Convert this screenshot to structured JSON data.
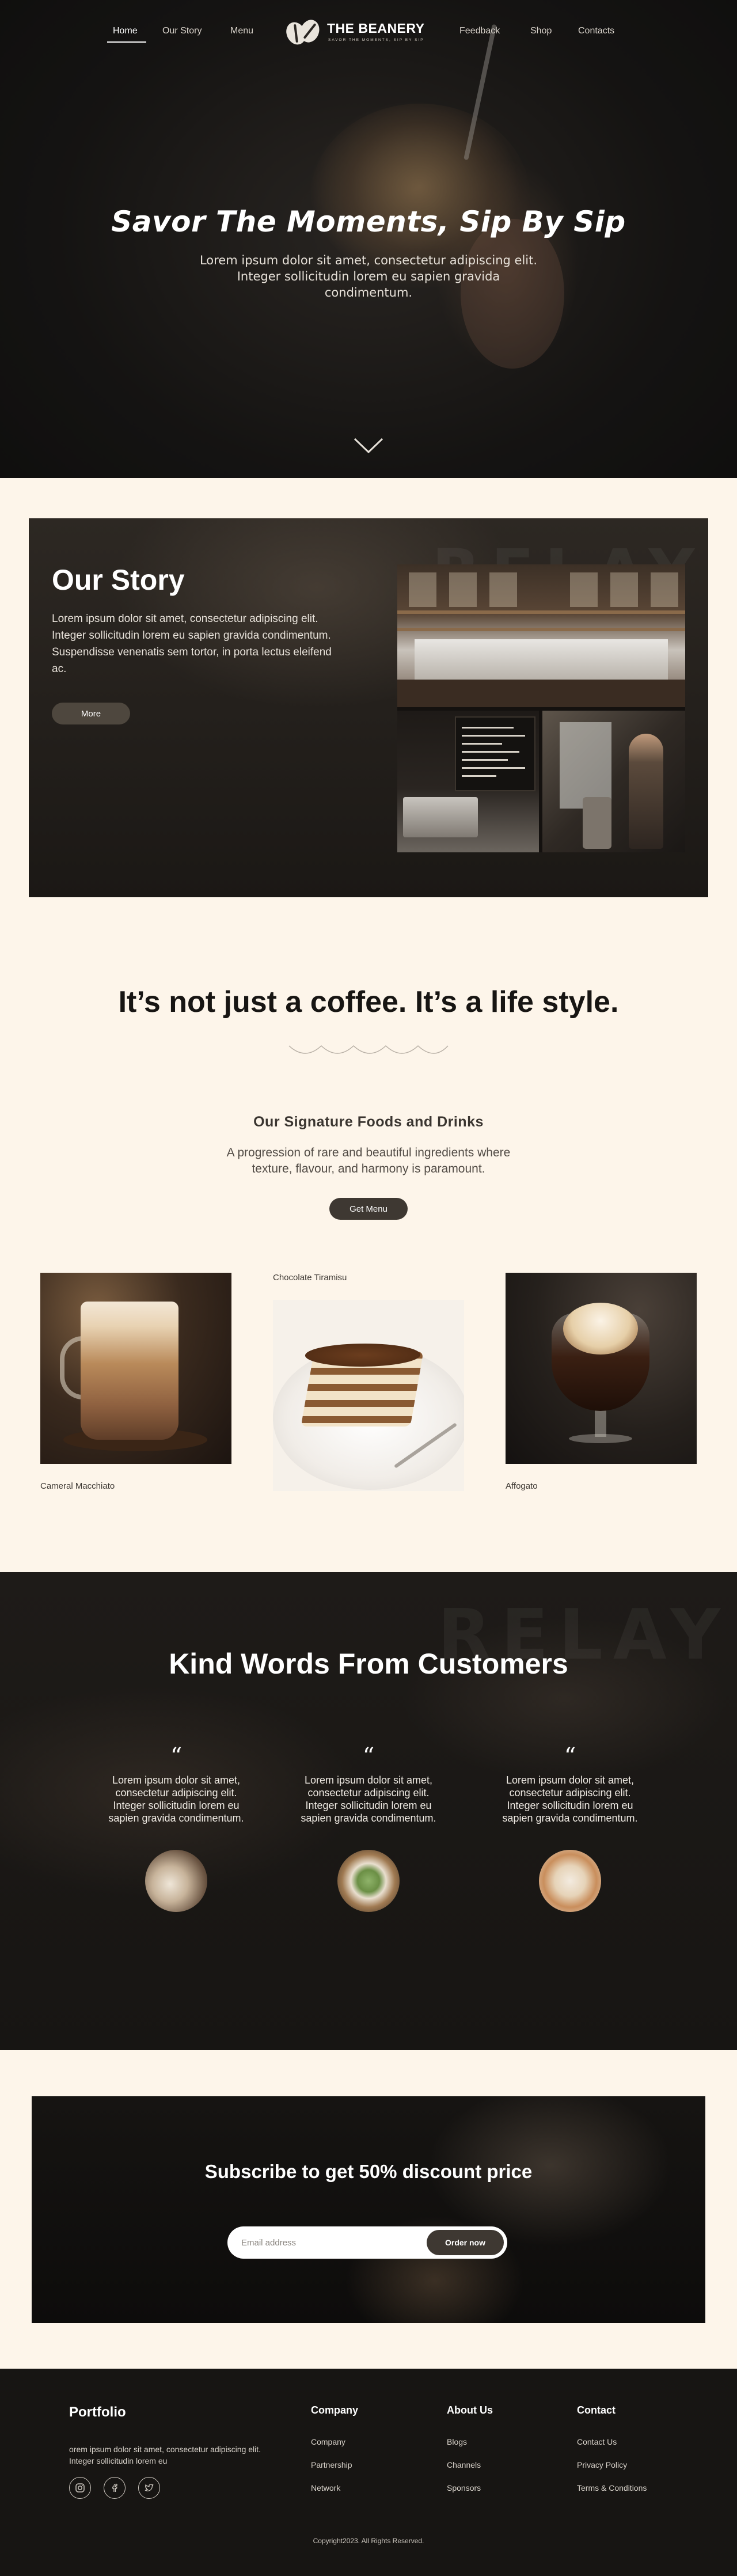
{
  "nav": {
    "home": "Home",
    "our_story": "Our Story",
    "menu": "Menu",
    "feedback": "Feedback",
    "shop": "Shop",
    "contacts": "Contacts"
  },
  "logo": {
    "name": "THE BEANERY",
    "tagline": "SAVOR THE MOMENTS, SIP BY SIP"
  },
  "hero": {
    "title": "Savor The Moments, Sip By Sip",
    "subtitle": "Lorem ipsum dolor sit amet, consectetur adipiscing elit. Integer sollicitudin lorem eu sapien gravida condimentum."
  },
  "story": {
    "title": "Our Story",
    "body": "Lorem ipsum dolor sit amet, consectetur adipiscing elit. Integer sollicitudin lorem eu sapien gravida condimentum. Suspendisse venenatis sem tortor, in porta lectus eleifend ac.",
    "button": "More",
    "sign_text": "RELAY"
  },
  "lifestyle": {
    "headline": "It’s not just a coffee. It’s a life style.",
    "signature_title": "Our Signature Foods and Drinks",
    "signature_sub": "A progression of rare and beautiful ingredients where texture, flavour, and harmony is paramount.",
    "button": "Get Menu",
    "items": [
      {
        "name": "Cameral Macchiato"
      },
      {
        "name": "Chocolate Tiramisu"
      },
      {
        "name": "Affogato"
      }
    ]
  },
  "testimonials": {
    "title": "Kind Words From Customers",
    "sign_text": "RELAY",
    "reviews": [
      {
        "quote_mark": "“",
        "text": "Lorem ipsum dolor sit amet, consectetur adipiscing elit. Integer sollicitudin lorem eu sapien gravida condimentum."
      },
      {
        "quote_mark": "“",
        "text": "Lorem ipsum dolor sit amet, consectetur adipiscing elit. Integer sollicitudin lorem eu sapien gravida condimentum."
      },
      {
        "quote_mark": "“",
        "text": "Lorem ipsum dolor sit amet, consectetur adipiscing elit. Integer sollicitudin lorem eu sapien gravida condimentum."
      }
    ]
  },
  "subscribe": {
    "title": "Subscribe to get 50% discount price",
    "placeholder": "Email address",
    "button": "Order now"
  },
  "footer": {
    "brand": "Portfolio",
    "about": "orem ipsum dolor sit amet, consectetur adipiscing elit. Integer sollicitudin lorem eu",
    "social_icons": [
      "instagram-icon",
      "facebook-icon",
      "twitter-icon"
    ],
    "columns": [
      {
        "title": "Company",
        "links": [
          "Company",
          "Partnership",
          "Network"
        ]
      },
      {
        "title": "About Us",
        "links": [
          "Blogs",
          "Channels",
          "Sponsors"
        ]
      },
      {
        "title": "Contact",
        "links": [
          "Contact Us",
          "Privacy Policy",
          "Terms & Conditions"
        ]
      }
    ],
    "copyright": "Copyright2023. All Rights Reserved."
  },
  "colors": {
    "cream_background": "#fdf5ea",
    "dark_brown_button": "#3e3832",
    "footer_background": "#171513"
  }
}
